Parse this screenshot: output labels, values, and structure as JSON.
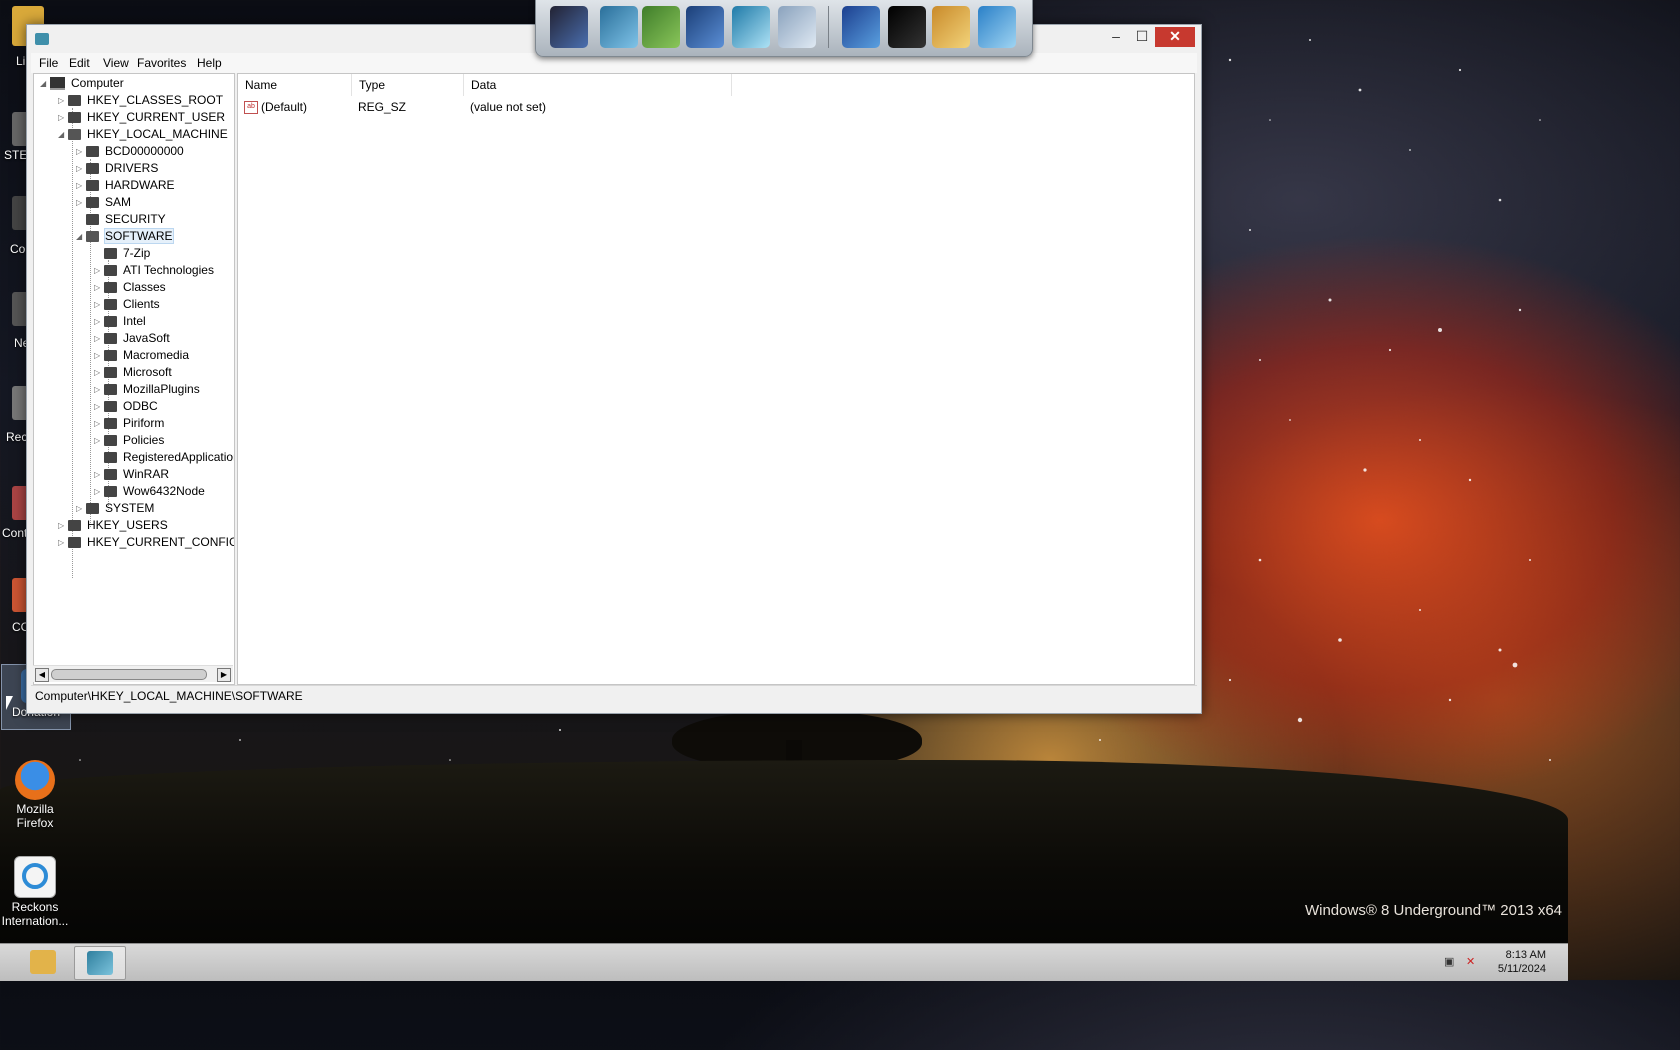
{
  "desktop": {
    "watermark": "Windows® 8 Underground™ 2013 x64",
    "icons": [
      {
        "label": "Donation"
      },
      {
        "label": "Mozilla Firefox"
      },
      {
        "label": "Reckons Internation..."
      }
    ],
    "partial_labels": [
      "Li",
      "STE",
      "Co",
      "Ne",
      "Rec",
      "Cont",
      "CC"
    ]
  },
  "window": {
    "menu": [
      "File",
      "Edit",
      "View",
      "Favorites",
      "Help"
    ],
    "controls": {
      "minimize": "–",
      "maximize": "☐",
      "close": "✕"
    },
    "tree": {
      "root": "Computer",
      "hives": [
        "HKEY_CLASSES_ROOT",
        "HKEY_CURRENT_USER",
        "HKEY_LOCAL_MACHINE"
      ],
      "hklm_children": [
        "BCD00000000",
        "DRIVERS",
        "HARDWARE",
        "SAM",
        "SECURITY",
        "SOFTWARE"
      ],
      "software_children": [
        "7-Zip",
        "ATI Technologies",
        "Classes",
        "Clients",
        "Intel",
        "JavaSoft",
        "Macromedia",
        "Microsoft",
        "MozillaPlugins",
        "ODBC",
        "Piriform",
        "Policies",
        "RegisteredApplications",
        "WinRAR",
        "Wow6432Node"
      ],
      "after_software": [
        "SYSTEM"
      ],
      "hives_after": [
        "HKEY_USERS",
        "HKEY_CURRENT_CONFIG"
      ],
      "selected": "SOFTWARE"
    },
    "list": {
      "columns": [
        "Name",
        "Type",
        "Data"
      ],
      "rows": [
        {
          "name": "(Default)",
          "type": "REG_SZ",
          "data": "(value not set)"
        }
      ]
    },
    "status_path": "Computer\\HKEY_LOCAL_MACHINE\\SOFTWARE"
  },
  "taskbar": {
    "time": "8:13 AM",
    "date": "5/11/2024"
  },
  "colors": {
    "close_button": "#c7392f",
    "selection": "#e5f0fa",
    "accent": "#3f8faa"
  }
}
